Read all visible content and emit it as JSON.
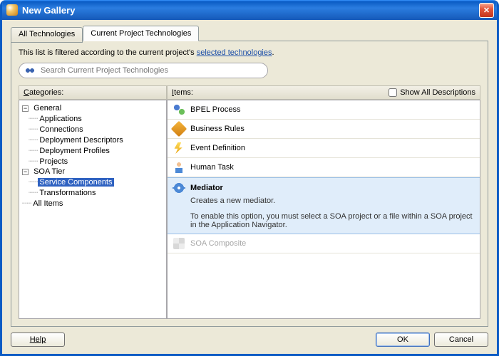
{
  "window": {
    "title": "New Gallery"
  },
  "tabs": {
    "all": "All Technologies",
    "current": "Current Project Technologies"
  },
  "filter_prefix": "This list is filtered according to the current project's ",
  "filter_link": "selected technologies",
  "search": {
    "placeholder": "Search Current Project Technologies"
  },
  "categories": {
    "label_pre": "C",
    "label_post": "ategories:",
    "general": "General",
    "applications": "Applications",
    "connections": "Connections",
    "deploy_desc": "Deployment Descriptors",
    "deploy_prof": "Deployment Profiles",
    "projects": "Projects",
    "soa_tier": "SOA Tier",
    "service_components": "Service Components",
    "transformations": "Transformations",
    "all_items": "All Items"
  },
  "items_header": {
    "label_pre": "I",
    "label_post": "tems:",
    "show_all": "Show All Descriptions"
  },
  "items": {
    "bpel": "BPEL Process",
    "rules": "Business Rules",
    "event": "Event Definition",
    "human": "Human Task",
    "mediator": "Mediator",
    "mediator_desc1": "Creates a new mediator.",
    "mediator_desc2": "To enable this option, you must select a SOA project or a file within a SOA project in the Application Navigator.",
    "composite": "SOA Composite"
  },
  "buttons": {
    "help": "Help",
    "ok": "OK",
    "cancel": "Cancel"
  }
}
